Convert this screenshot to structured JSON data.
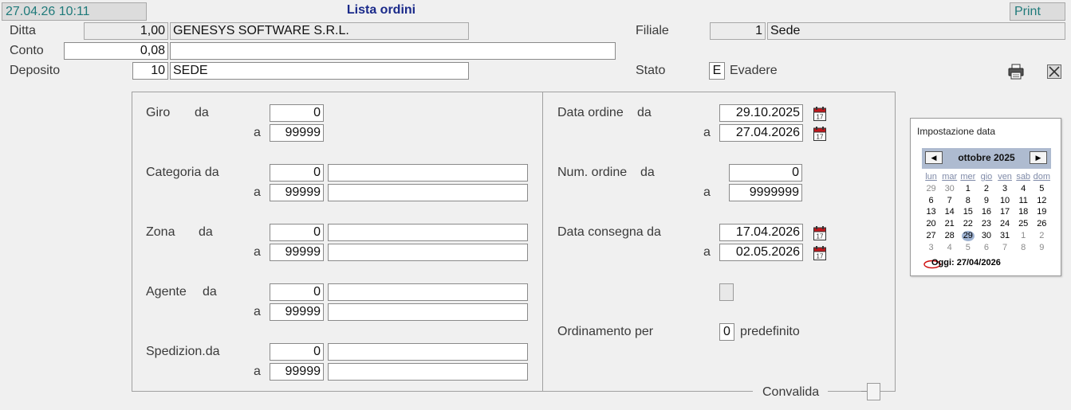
{
  "header": {
    "datetime": "27.04.26 10:11",
    "title": "Lista ordini",
    "print_label": "Print"
  },
  "top": {
    "ditta": {
      "label": "Ditta",
      "code": "1,00",
      "name": "GENESYS SOFTWARE S.R.L."
    },
    "conto": {
      "label": "Conto",
      "code": "0,08",
      "name": ""
    },
    "deposito": {
      "label": "Deposito",
      "code": "10",
      "name": "SEDE"
    },
    "filiale": {
      "label": "Filiale",
      "code": "1",
      "name": "Sede"
    },
    "stato": {
      "label": "Stato",
      "code": "E",
      "name": "Evadere"
    }
  },
  "left_group": {
    "giro": {
      "label": "Giro",
      "da_label": "da",
      "a_label": "a",
      "from": "0",
      "to": "99999"
    },
    "categoria": {
      "label": "Categoria da",
      "a_label": "a",
      "from": "0",
      "to": "99999",
      "from_desc": "",
      "to_desc": ""
    },
    "zona": {
      "label": "Zona",
      "da_label": "da",
      "a_label": "a",
      "from": "0",
      "to": "99999",
      "from_desc": "",
      "to_desc": ""
    },
    "agente": {
      "label": "Agente",
      "da_label": "da",
      "a_label": "a",
      "from": "0",
      "to": "99999",
      "from_desc": "",
      "to_desc": ""
    },
    "spedizion": {
      "label": "Spedizion.da",
      "a_label": "a",
      "from": "0",
      "to": "99999",
      "from_desc": "",
      "to_desc": ""
    }
  },
  "right_group": {
    "data_ordine": {
      "label": "Data ordine",
      "da_label": "da",
      "a_label": "a",
      "from": "29.10.2025",
      "to": "27.04.2026"
    },
    "num_ordine": {
      "label": "Num. ordine",
      "da_label": "da",
      "a_label": "a",
      "from": "0",
      "to": "9999999"
    },
    "data_consegna": {
      "label": "Data consegna da",
      "a_label": "a",
      "from": "17.04.2026",
      "to": "02.05.2026"
    },
    "ordinamento": {
      "label": "Ordinamento per",
      "code": "0",
      "desc": "predefinito"
    }
  },
  "convalida_label": "Convalida",
  "calendar": {
    "title": "Impostazione data",
    "month": "ottobre 2025",
    "weekdays": [
      "lun",
      "mar",
      "mer",
      "gio",
      "ven",
      "sab",
      "dom"
    ],
    "weeks": [
      [
        "29",
        "30",
        "1",
        "2",
        "3",
        "4",
        "5"
      ],
      [
        "6",
        "7",
        "8",
        "9",
        "10",
        "11",
        "12"
      ],
      [
        "13",
        "14",
        "15",
        "16",
        "17",
        "18",
        "19"
      ],
      [
        "20",
        "21",
        "22",
        "23",
        "24",
        "25",
        "26"
      ],
      [
        "27",
        "28",
        "29",
        "30",
        "31",
        "1",
        "2"
      ],
      [
        "3",
        "4",
        "5",
        "6",
        "7",
        "8",
        "9"
      ]
    ],
    "selected_day": "29",
    "today_label": "Oggi: 27/04/2026"
  },
  "colors": {
    "title": "#1a2a8a",
    "header_text": "#1f7a7a",
    "calendar_header": "#aebbd0",
    "calendar_selected": "#9fb3d2"
  }
}
